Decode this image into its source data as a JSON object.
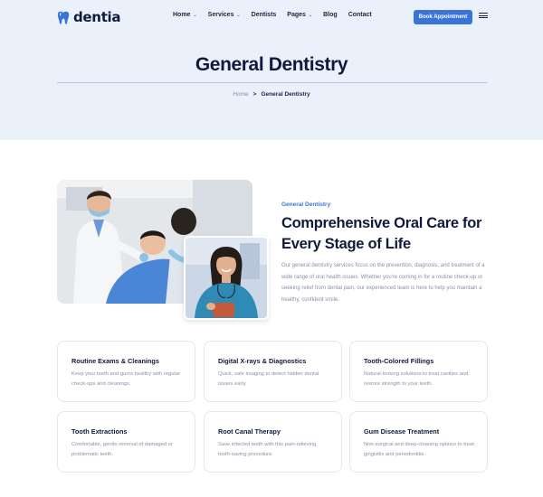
{
  "brand": {
    "name": "dentia",
    "accent": "#3b74d8"
  },
  "nav": {
    "items": [
      {
        "label": "Home",
        "dropdown": true
      },
      {
        "label": "Services",
        "dropdown": true
      },
      {
        "label": "Dentists",
        "dropdown": false
      },
      {
        "label": "Pages",
        "dropdown": true
      },
      {
        "label": "Blog",
        "dropdown": false
      },
      {
        "label": "Contact",
        "dropdown": false
      }
    ],
    "cta_label": "Book Appointment"
  },
  "hero": {
    "title": "General Dentistry",
    "breadcrumb": {
      "home": "Home",
      "separator": ">",
      "current": "General Dentistry"
    }
  },
  "about": {
    "eyebrow": "General Dentistry",
    "heading_line1": "Comprehensive Oral Care for",
    "heading_line2": "Every Stage of Life",
    "description": "Our general dentistry services focus on the prevention, diagnosis, and treatment of a wide range of oral health issues. Whether you're coming in for a routine check-up or seeking relief from dental pain, our experienced team is here to help you maintain a healthy, confident smile."
  },
  "services": [
    {
      "title": "Routine Exams & Cleanings",
      "text": "Keep your teeth and gums healthy with regular check-ups and cleanings."
    },
    {
      "title": "Digital X-rays & Diagnostics",
      "text": "Quick, safe imaging to detect hidden dental issues early."
    },
    {
      "title": "Tooth-Colored Fillings",
      "text": "Natural-looking solutions to treat cavities and restore strength to your teeth."
    },
    {
      "title": "Tooth Extractions",
      "text": "Comfortable, gentle removal of damaged or problematic teeth."
    },
    {
      "title": "Root Canal Therapy",
      "text": "Save infected teeth with this pain-relieving, tooth-saving procedure."
    },
    {
      "title": "Gum Disease Treatment",
      "text": "Non-surgical and deep-cleaning options to treat gingivitis and periodontitis."
    }
  ]
}
